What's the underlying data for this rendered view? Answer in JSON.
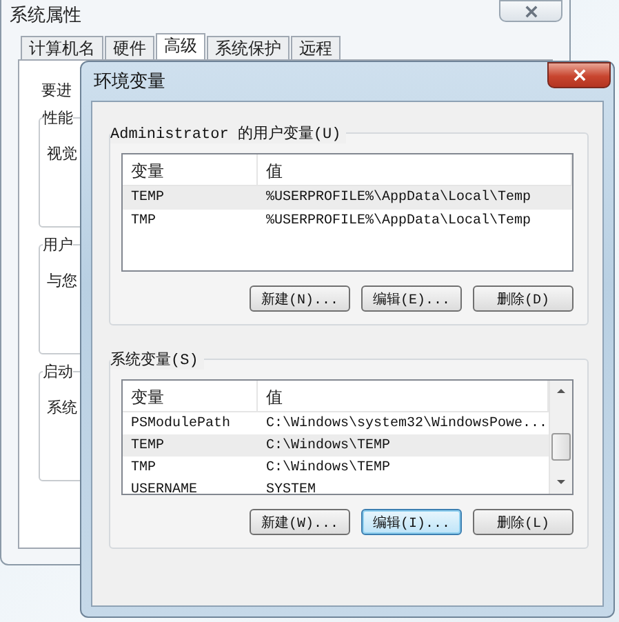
{
  "back_window": {
    "title": "系统属性",
    "tabs": [
      {
        "label": "计算机名",
        "selected": false
      },
      {
        "label": "硬件",
        "selected": false
      },
      {
        "label": "高级",
        "selected": true
      },
      {
        "label": "系统保护",
        "selected": false
      },
      {
        "label": "远程",
        "selected": false
      }
    ],
    "intro": "要进",
    "groups": [
      {
        "label": "性能",
        "text": "视觉"
      },
      {
        "label": "用户",
        "text": "与您"
      },
      {
        "label": "启动",
        "text": "系统"
      }
    ]
  },
  "window": {
    "title": "环境变量",
    "sections": [
      {
        "label": "Administrator 的用户变量(U)",
        "columns": [
          "变量",
          "值"
        ],
        "scrollbar": false,
        "rows": [
          {
            "name": "TEMP",
            "value": "%USERPROFILE%\\AppData\\Local\\Temp",
            "selected": true
          },
          {
            "name": "TMP",
            "value": "%USERPROFILE%\\AppData\\Local\\Temp",
            "selected": false
          }
        ],
        "buttons": [
          {
            "label": "新建(N)...",
            "focused": false
          },
          {
            "label": "编辑(E)...",
            "focused": false
          },
          {
            "label": "删除(D)",
            "focused": false
          }
        ]
      },
      {
        "label": "系统变量(S)",
        "columns": [
          "变量",
          "值"
        ],
        "scrollbar": true,
        "rows": [
          {
            "name": "PSModulePath",
            "value": "C:\\Windows\\system32\\WindowsPowe...",
            "selected": false
          },
          {
            "name": "TEMP",
            "value": "C:\\Windows\\TEMP",
            "selected": true
          },
          {
            "name": "TMP",
            "value": "C:\\Windows\\TEMP",
            "selected": false
          },
          {
            "name": "USERNAME",
            "value": "SYSTEM",
            "selected": false
          }
        ],
        "buttons": [
          {
            "label": "新建(W)...",
            "focused": false
          },
          {
            "label": "编辑(I)...",
            "focused": true
          },
          {
            "label": "删除(L)",
            "focused": false
          }
        ]
      }
    ]
  }
}
